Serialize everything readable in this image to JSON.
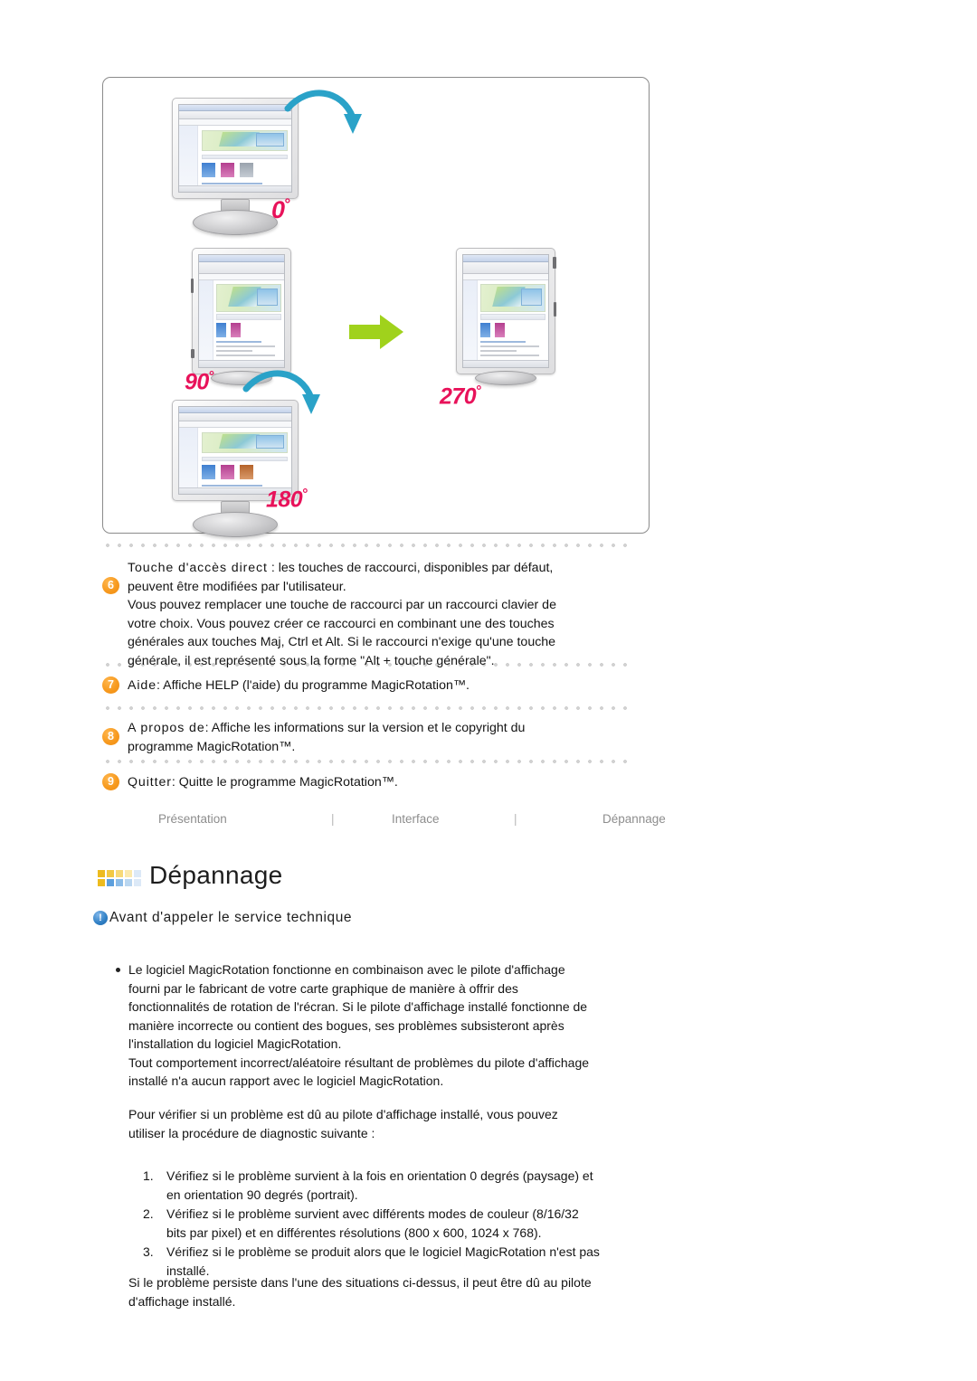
{
  "illustration": {
    "caption_alt": "Rotation du moniteur : 0, 90, 180, 270 degres",
    "degree_labels": [
      {
        "value": "0",
        "unit": "°"
      },
      {
        "value": "90",
        "unit": "°"
      },
      {
        "value": "180",
        "unit": "°"
      },
      {
        "value": "270",
        "unit": "°"
      }
    ],
    "accent_color": "#e8125a",
    "arrow_color": "#2aa2c8",
    "transition_arrow_color": "#a0d21c"
  },
  "numbered_items": [
    {
      "number": "6",
      "label": "Touche d'accès direct",
      "lines": [
        " : les touches de raccourci, disponibles par défaut,",
        "peuvent être modifiées par l'utilisateur.",
        "Vous pouvez remplacer une touche de raccourci par un raccourci clavier de",
        "votre choix. Vous pouvez créer ce raccourci en combinant une des touches",
        "générales aux touches Maj, Ctrl et Alt. Si le raccourci n'exige qu'une touche",
        "générale, il est représenté sous la forme \"Alt + touche générale\"."
      ]
    },
    {
      "number": "7",
      "label": "Aide",
      "lines": [
        ": Affiche HELP (l'aide) du programme MagicRotation™."
      ]
    },
    {
      "number": "8",
      "label": "A propos de",
      "lines": [
        ": Affiche les informations sur la version et le copyright du",
        "programme MagicRotation™."
      ]
    },
    {
      "number": "9",
      "label": "Quitter",
      "lines": [
        ": Quitte le programme MagicRotation™."
      ]
    }
  ],
  "nav": {
    "links": [
      "Présentation",
      "Interface",
      "Dépannage"
    ],
    "separator": "|"
  },
  "section": {
    "title": "Dépannage",
    "icon_name": "squares-grid-icon",
    "icon_colors_top": [
      "#edbb1e",
      "#f2c944",
      "#f7d977",
      "#fbe9ad",
      "#dce9f7"
    ],
    "icon_colors_bottom": [
      "#edbb1e",
      "#5c9fdd",
      "#8cbce8",
      "#b9d6f0",
      "#dce9f7"
    ]
  },
  "subsection": {
    "icon_name": "info-icon",
    "icon_glyph": "!",
    "title": "Avant d'appeler le service technique"
  },
  "content": {
    "bullet_paragraph_1": [
      "Le logiciel MagicRotation fonctionne en combinaison avec le pilote d'affichage",
      "fourni par le fabricant de votre carte graphique de manière à offrir des",
      "fonctionnalités de rotation de l'récran. Si le pilote d'affichage installé fonctionne de",
      "manière incorrecte ou contient des bogues, ses problèmes subsisteront après",
      "l'installation du logiciel MagicRotation."
    ],
    "bullet_paragraph_2": [
      "Tout comportement incorrect/aléatoire résultant de problèmes du pilote d'affichage",
      "installé n'a aucun rapport avec le logiciel MagicRotation."
    ],
    "intro_paragraph": [
      "Pour vérifier si un problème est dû au pilote d'affichage installé, vous pouvez",
      "utiliser la procédure de diagnostic suivante :"
    ],
    "steps": [
      {
        "number": "1.",
        "lines": [
          "Vérifiez si le problème survient à la fois en orientation 0 degrés (paysage) et",
          "en orientation 90 degrés (portrait)."
        ]
      },
      {
        "number": "2.",
        "lines": [
          "Vérifiez si le problème survient avec différents modes de couleur (8/16/32",
          "bits par pixel) et en différentes résolutions (800 x 600, 1024 x 768)."
        ]
      },
      {
        "number": "3.",
        "lines": [
          "Vérifiez si le problème se produit alors que le logiciel MagicRotation n'est pas",
          "installé."
        ]
      }
    ],
    "closing_paragraph": [
      "Si le problème persiste dans l'une des situations ci-dessus, il peut être dû au pilote",
      "d'affichage installé."
    ]
  }
}
